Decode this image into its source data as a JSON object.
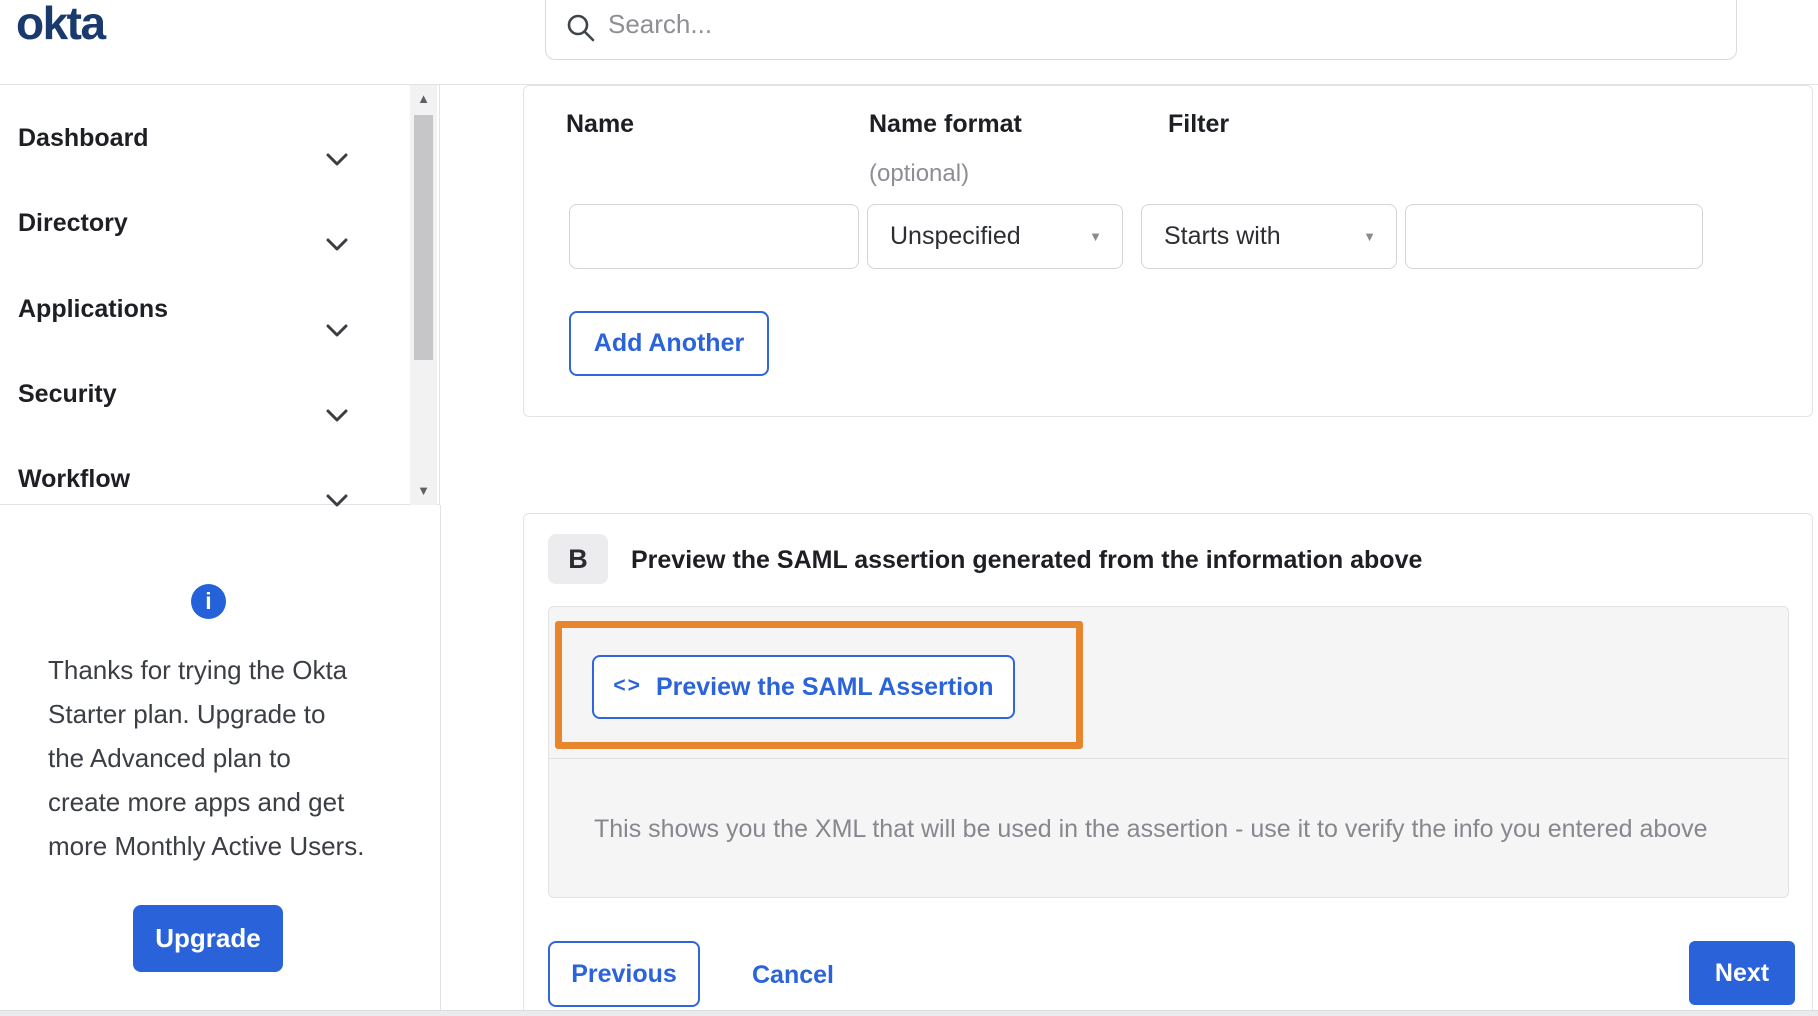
{
  "brand": {
    "logo_text": "okta"
  },
  "search": {
    "placeholder": "Search..."
  },
  "sidebar": {
    "items": [
      {
        "label": "Dashboard"
      },
      {
        "label": "Directory"
      },
      {
        "label": "Applications"
      },
      {
        "label": "Security"
      },
      {
        "label": "Workflow"
      }
    ],
    "upsell": {
      "message_lines": [
        "Thanks for trying the Okta",
        "Starter plan. Upgrade to",
        "the Advanced plan to",
        "create more apps and get",
        "more Monthly Active Users."
      ],
      "upgrade_label": "Upgrade"
    }
  },
  "attribute_form": {
    "columns": {
      "name_label": "Name",
      "name_format_label": "Name format",
      "name_format_sublabel": "(optional)",
      "filter_label": "Filter"
    },
    "name_value": "",
    "name_format_selected": "Unspecified",
    "filter_type_selected": "Starts with",
    "filter_value": "",
    "add_another_label": "Add Another"
  },
  "preview_section": {
    "badge": "B",
    "heading": "Preview the SAML assertion generated from the information above",
    "preview_button_label": "Preview the SAML Assertion",
    "hint_text": "This shows you the XML that will be used in the assertion - use it to verify the info you entered above"
  },
  "footer": {
    "previous_label": "Previous",
    "cancel_label": "Cancel",
    "next_label": "Next"
  },
  "icons": {
    "code": "<>",
    "info": "i",
    "caret_down": "▼",
    "scroll_up": "▲",
    "scroll_down": "▼"
  },
  "colors": {
    "accent_blue": "#2a63d9",
    "brand_navy": "#1a3a6e",
    "highlight_orange": "#e8862d",
    "muted_text": "#87878e"
  }
}
